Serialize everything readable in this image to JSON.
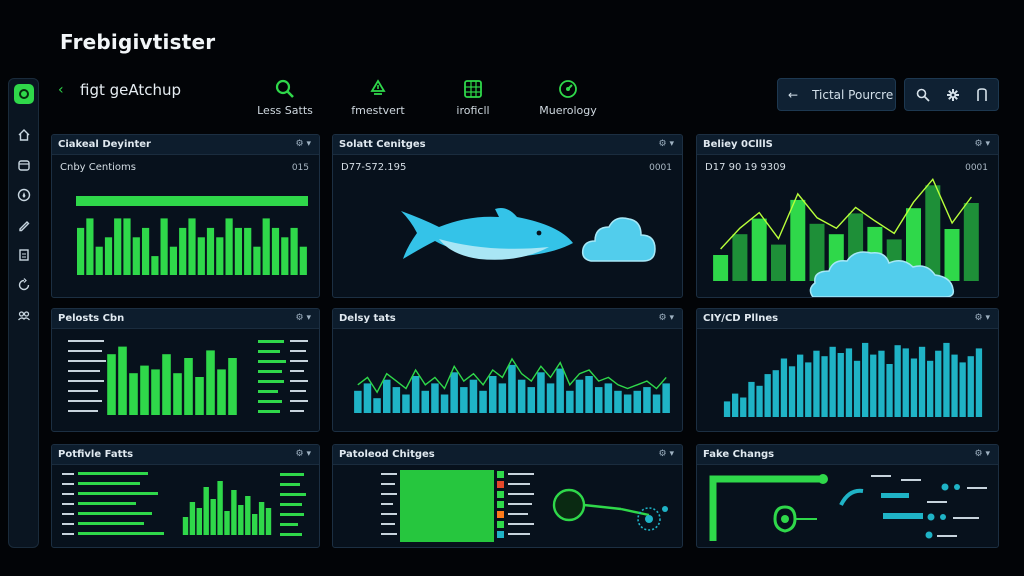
{
  "app": {
    "title": "Frebigivtister"
  },
  "toolbar": {
    "back_glyph": "‹",
    "title": "figt geAtchup"
  },
  "tabs": [
    {
      "label": "Less Satts",
      "icon": "search-icon"
    },
    {
      "label": "fmestvert",
      "icon": "recycle-icon"
    },
    {
      "label": "iroficll",
      "icon": "grid-icon"
    },
    {
      "label": "Muerology",
      "icon": "gauge-icon"
    }
  ],
  "header_actions": {
    "total_label": "Tictal Pourcre",
    "icons": [
      "search-icon",
      "settings-icon",
      "bookmark-icon"
    ]
  },
  "sidebar": {
    "icons": [
      "logo-icon",
      "home-icon",
      "calendar-icon",
      "compass-icon",
      "pencil-icon",
      "document-icon",
      "refresh-icon",
      "group-icon"
    ]
  },
  "menu_glyph": "⚙ ▾",
  "panels": [
    {
      "title": "Ciakeal Deyinter",
      "subtitle": "Cnby Centioms",
      "subtitle_right": "015"
    },
    {
      "title": "Solatt Cenitges",
      "subtitle": "D77-S72.195",
      "subtitle_right": "0001"
    },
    {
      "title": "Beliey 0ClllS",
      "subtitle": "D17 90 19 9309",
      "subtitle_right": "0001"
    },
    {
      "title": "Pelosts Cbn"
    },
    {
      "title": "Delsy tats"
    },
    {
      "title": "CIY/CD Pllnes"
    },
    {
      "title": "Potfivle Fatts"
    },
    {
      "title": "Patoleod Chitges"
    },
    {
      "title": "Fake Changs"
    }
  ],
  "colors": {
    "accent": "#2fd84a",
    "cyan": "#1fb3c6",
    "cyan_bright": "#46c8e6",
    "panel_bg": "#07111c",
    "border": "#1c2f42"
  },
  "chart_data": [
    {
      "type": "bar",
      "panel": "Ciakeal Deyinter",
      "series": [
        {
          "values": [
            5,
            6,
            3,
            4,
            6,
            6,
            4,
            5,
            2,
            6,
            3,
            5,
            6,
            4,
            5,
            4,
            6,
            5,
            5,
            3,
            6,
            5,
            4,
            5,
            3
          ]
        }
      ],
      "ylim": [
        0,
        7
      ]
    },
    {
      "type": "bar",
      "panel": "Beliey 0ClllS",
      "series": [
        {
          "values": [
            25,
            45,
            60,
            35,
            78,
            55,
            45,
            65,
            52,
            40,
            70,
            92,
            50,
            75
          ]
        }
      ],
      "ylim": [
        0,
        100
      ]
    },
    {
      "type": "bar",
      "panel": "Pelosts Cbn",
      "series": [
        {
          "values": [
            80,
            90,
            55,
            65,
            60,
            80,
            55,
            75,
            50,
            85,
            60,
            75
          ]
        }
      ],
      "ylim": [
        0,
        100
      ]
    },
    {
      "type": "bar",
      "panel": "Delsy tats",
      "series": [
        {
          "values": [
            30,
            40,
            20,
            45,
            35,
            25,
            50,
            30,
            40,
            25,
            55,
            35,
            45,
            30,
            50,
            40,
            65,
            45,
            35,
            55,
            40,
            60,
            30,
            45,
            50,
            35,
            40,
            30,
            25,
            30,
            35,
            25,
            40
          ]
        }
      ],
      "ylim": [
        0,
        100
      ]
    },
    {
      "type": "bar",
      "panel": "CIY/CD Pllnes",
      "series": [
        {
          "values": [
            20,
            30,
            25,
            45,
            40,
            55,
            60,
            75,
            65,
            80,
            70,
            85,
            78,
            90,
            82,
            88,
            72,
            95,
            80,
            85,
            68,
            92,
            88,
            75,
            90,
            72,
            85,
            95,
            80,
            70,
            78,
            88
          ]
        }
      ],
      "ylim": [
        0,
        100
      ]
    },
    {
      "type": "bar",
      "panel": "Potfivle Fatts",
      "series": [
        {
          "values": [
            30,
            55,
            45,
            80,
            60,
            90,
            40,
            75,
            50,
            65,
            35,
            55,
            45
          ]
        }
      ],
      "ylim": [
        0,
        100
      ]
    }
  ]
}
